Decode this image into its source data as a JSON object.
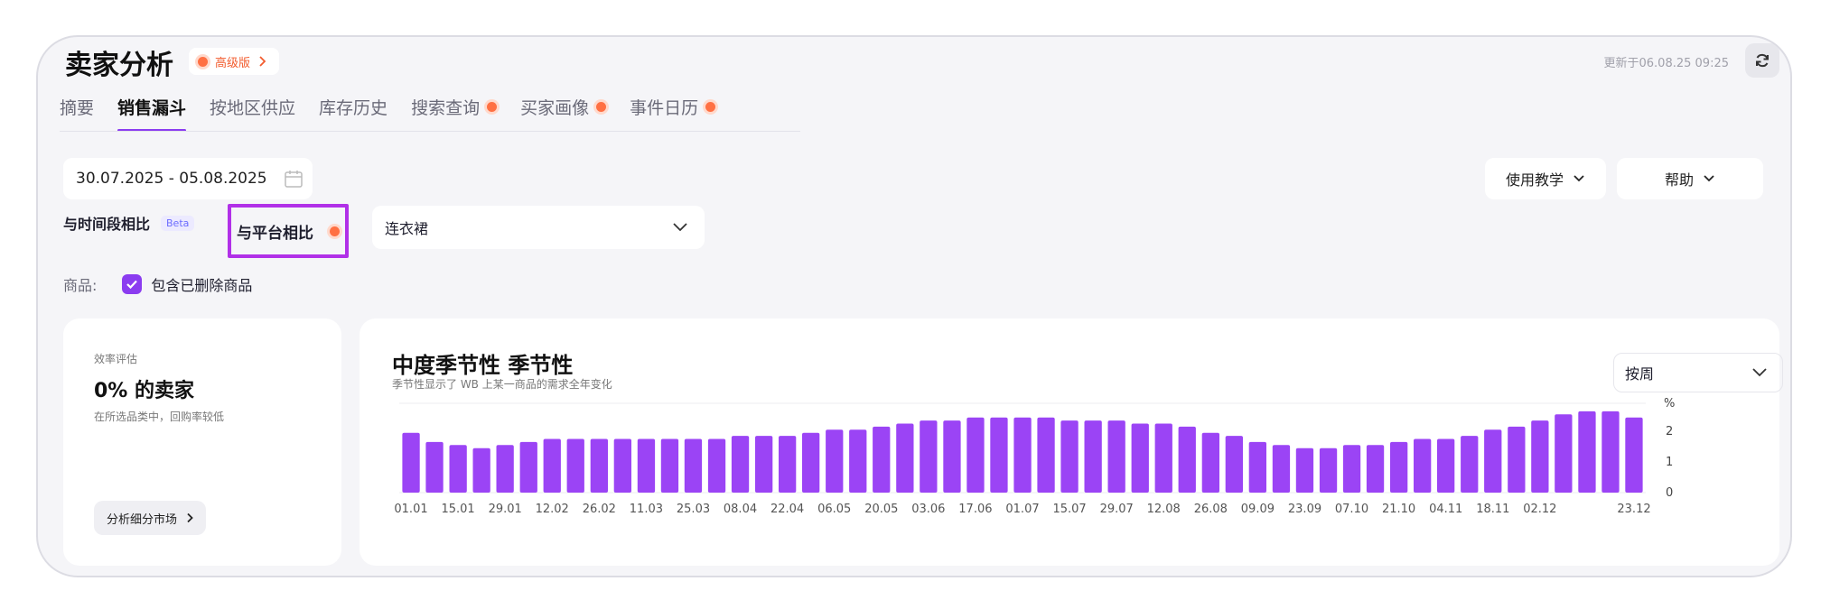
{
  "header": {
    "title": "卖家分析",
    "badge": "高级版",
    "updated": "更新于06.08.25 09:25"
  },
  "tabs": [
    {
      "label": "摘要",
      "dot": false
    },
    {
      "label": "销售漏斗",
      "dot": false,
      "active": true
    },
    {
      "label": "按地区供应",
      "dot": false
    },
    {
      "label": "库存历史",
      "dot": false
    },
    {
      "label": "搜索查询",
      "dot": true
    },
    {
      "label": "买家画像",
      "dot": true
    },
    {
      "label": "事件日历",
      "dot": true
    }
  ],
  "filters": {
    "date_range": "30.07.2025 - 05.08.2025",
    "tutorial": "使用教学",
    "help": "帮助",
    "compare_period": "与时间段相比",
    "beta": "Beta",
    "compare_platform": "与平台相比",
    "category": "连衣裙",
    "goods_label": "商品:",
    "include_deleted": "包含已删除商品"
  },
  "left_card": {
    "caption": "效率评估",
    "headline": "0% 的卖家",
    "description": "在所选品类中，回购率较低",
    "button": "分析细分市场"
  },
  "chart_card": {
    "title": "中度季节性 季节性",
    "subtitle": "季节性显示了 WB 上某一商品的需求全年变化",
    "period": "按周"
  },
  "chart_data": {
    "type": "bar",
    "unit": "%",
    "ylim": [
      0,
      2.5
    ],
    "yticks": [
      0,
      1,
      2
    ],
    "xtick_labels": [
      "01.01",
      "15.01",
      "29.01",
      "12.02",
      "26.02",
      "11.03",
      "25.03",
      "08.04",
      "22.04",
      "06.05",
      "20.05",
      "03.06",
      "17.06",
      "01.07",
      "15.07",
      "29.07",
      "12.08",
      "26.08",
      "09.09",
      "23.09",
      "07.10",
      "21.10",
      "04.11",
      "18.11",
      "02.12",
      "23.12"
    ],
    "values": [
      1.95,
      1.65,
      1.55,
      1.45,
      1.55,
      1.65,
      1.75,
      1.75,
      1.75,
      1.75,
      1.75,
      1.75,
      1.75,
      1.75,
      1.85,
      1.85,
      1.85,
      1.95,
      2.05,
      2.05,
      2.15,
      2.25,
      2.35,
      2.35,
      2.45,
      2.45,
      2.45,
      2.45,
      2.35,
      2.35,
      2.35,
      2.25,
      2.25,
      2.15,
      1.95,
      1.85,
      1.65,
      1.55,
      1.45,
      1.45,
      1.55,
      1.55,
      1.65,
      1.75,
      1.75,
      1.85,
      2.05,
      2.15,
      2.35,
      2.55,
      2.65,
      2.65,
      2.45
    ]
  },
  "colors": {
    "accent": "#8b3cf0",
    "bar": "#9b44f5",
    "highlight": "#b130e8",
    "dot": "#ff7043"
  }
}
